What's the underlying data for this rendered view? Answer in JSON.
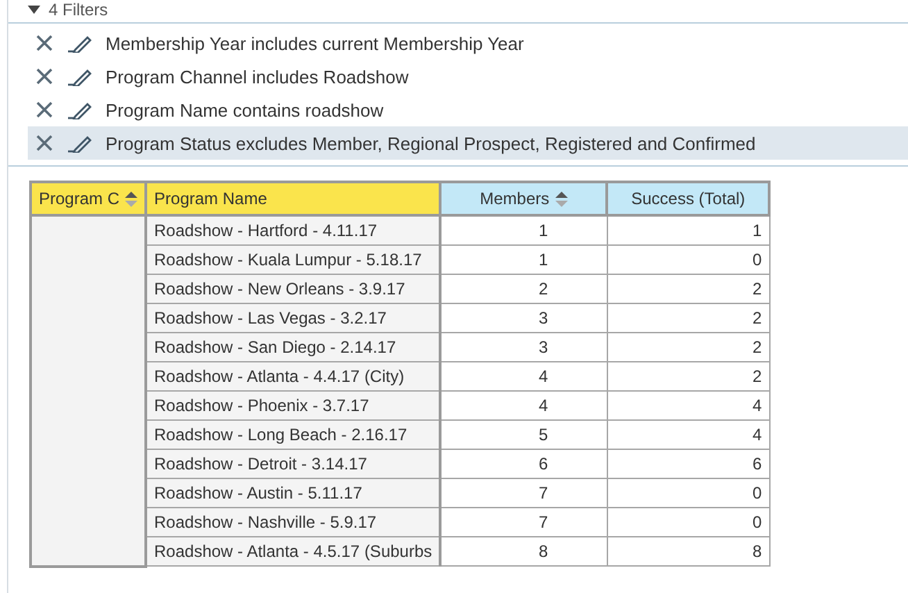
{
  "filters_header": {
    "label": "4 Filters",
    "expanded": true
  },
  "filters": [
    {
      "text": "Membership Year includes current Membership Year",
      "selected": false
    },
    {
      "text": "Program Channel includes Roadshow",
      "selected": false
    },
    {
      "text": "Program Name contains roadshow",
      "selected": false
    },
    {
      "text": "Program Status excludes Member, Regional Prospect, Registered and Confirmed",
      "selected": true
    }
  ],
  "table": {
    "columns": [
      {
        "label": "Program C",
        "kind": "group",
        "sortable": true
      },
      {
        "label": "Program Name",
        "kind": "group",
        "sortable": false
      },
      {
        "label": "Members",
        "kind": "metric",
        "sortable": true
      },
      {
        "label": "Success (Total)",
        "kind": "metric",
        "sortable": false
      }
    ],
    "rows": [
      [
        "",
        "Roadshow - Hartford - 4.11.17",
        "1",
        "1"
      ],
      [
        "",
        "Roadshow - Kuala Lumpur - 5.18.17",
        "1",
        "0"
      ],
      [
        "",
        "Roadshow - New Orleans - 3.9.17",
        "2",
        "2"
      ],
      [
        "",
        "Roadshow - Las Vegas - 3.2.17",
        "3",
        "2"
      ],
      [
        "",
        "Roadshow - San Diego - 2.14.17",
        "3",
        "2"
      ],
      [
        "",
        "Roadshow - Atlanta - 4.4.17 (City)",
        "4",
        "2"
      ],
      [
        "",
        "Roadshow - Phoenix - 3.7.17",
        "4",
        "4"
      ],
      [
        "",
        "Roadshow - Long Beach - 2.16.17",
        "5",
        "4"
      ],
      [
        "",
        "Roadshow - Detroit - 3.14.17",
        "6",
        "6"
      ],
      [
        "",
        "Roadshow - Austin - 5.11.17",
        "7",
        "0"
      ],
      [
        "",
        "Roadshow - Nashville - 5.9.17",
        "7",
        "0"
      ],
      [
        "",
        "Roadshow - Atlanta - 4.5.17 (Suburbs",
        "8",
        "8"
      ]
    ]
  }
}
